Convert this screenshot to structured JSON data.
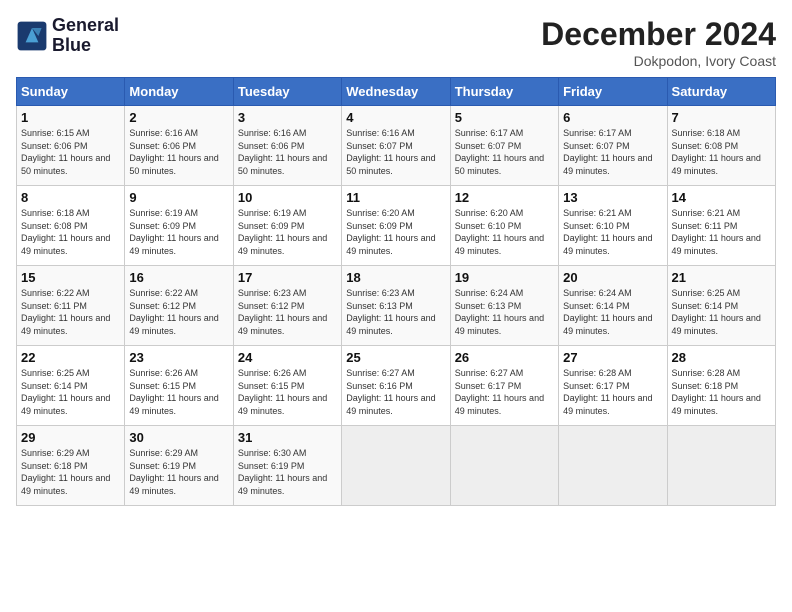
{
  "header": {
    "logo_line1": "General",
    "logo_line2": "Blue",
    "month_year": "December 2024",
    "location": "Dokpodon, Ivory Coast"
  },
  "weekdays": [
    "Sunday",
    "Monday",
    "Tuesday",
    "Wednesday",
    "Thursday",
    "Friday",
    "Saturday"
  ],
  "weeks": [
    [
      {
        "day": 1,
        "sunrise": "6:15 AM",
        "sunset": "6:06 PM",
        "daylight": "Daylight: 11 hours and 50 minutes."
      },
      {
        "day": 2,
        "sunrise": "6:16 AM",
        "sunset": "6:06 PM",
        "daylight": "Daylight: 11 hours and 50 minutes."
      },
      {
        "day": 3,
        "sunrise": "6:16 AM",
        "sunset": "6:06 PM",
        "daylight": "Daylight: 11 hours and 50 minutes."
      },
      {
        "day": 4,
        "sunrise": "6:16 AM",
        "sunset": "6:07 PM",
        "daylight": "Daylight: 11 hours and 50 minutes."
      },
      {
        "day": 5,
        "sunrise": "6:17 AM",
        "sunset": "6:07 PM",
        "daylight": "Daylight: 11 hours and 50 minutes."
      },
      {
        "day": 6,
        "sunrise": "6:17 AM",
        "sunset": "6:07 PM",
        "daylight": "Daylight: 11 hours and 49 minutes."
      },
      {
        "day": 7,
        "sunrise": "6:18 AM",
        "sunset": "6:08 PM",
        "daylight": "Daylight: 11 hours and 49 minutes."
      }
    ],
    [
      {
        "day": 8,
        "sunrise": "6:18 AM",
        "sunset": "6:08 PM",
        "daylight": "Daylight: 11 hours and 49 minutes."
      },
      {
        "day": 9,
        "sunrise": "6:19 AM",
        "sunset": "6:09 PM",
        "daylight": "Daylight: 11 hours and 49 minutes."
      },
      {
        "day": 10,
        "sunrise": "6:19 AM",
        "sunset": "6:09 PM",
        "daylight": "Daylight: 11 hours and 49 minutes."
      },
      {
        "day": 11,
        "sunrise": "6:20 AM",
        "sunset": "6:09 PM",
        "daylight": "Daylight: 11 hours and 49 minutes."
      },
      {
        "day": 12,
        "sunrise": "6:20 AM",
        "sunset": "6:10 PM",
        "daylight": "Daylight: 11 hours and 49 minutes."
      },
      {
        "day": 13,
        "sunrise": "6:21 AM",
        "sunset": "6:10 PM",
        "daylight": "Daylight: 11 hours and 49 minutes."
      },
      {
        "day": 14,
        "sunrise": "6:21 AM",
        "sunset": "6:11 PM",
        "daylight": "Daylight: 11 hours and 49 minutes."
      }
    ],
    [
      {
        "day": 15,
        "sunrise": "6:22 AM",
        "sunset": "6:11 PM",
        "daylight": "Daylight: 11 hours and 49 minutes."
      },
      {
        "day": 16,
        "sunrise": "6:22 AM",
        "sunset": "6:12 PM",
        "daylight": "Daylight: 11 hours and 49 minutes."
      },
      {
        "day": 17,
        "sunrise": "6:23 AM",
        "sunset": "6:12 PM",
        "daylight": "Daylight: 11 hours and 49 minutes."
      },
      {
        "day": 18,
        "sunrise": "6:23 AM",
        "sunset": "6:13 PM",
        "daylight": "Daylight: 11 hours and 49 minutes."
      },
      {
        "day": 19,
        "sunrise": "6:24 AM",
        "sunset": "6:13 PM",
        "daylight": "Daylight: 11 hours and 49 minutes."
      },
      {
        "day": 20,
        "sunrise": "6:24 AM",
        "sunset": "6:14 PM",
        "daylight": "Daylight: 11 hours and 49 minutes."
      },
      {
        "day": 21,
        "sunrise": "6:25 AM",
        "sunset": "6:14 PM",
        "daylight": "Daylight: 11 hours and 49 minutes."
      }
    ],
    [
      {
        "day": 22,
        "sunrise": "6:25 AM",
        "sunset": "6:14 PM",
        "daylight": "Daylight: 11 hours and 49 minutes."
      },
      {
        "day": 23,
        "sunrise": "6:26 AM",
        "sunset": "6:15 PM",
        "daylight": "Daylight: 11 hours and 49 minutes."
      },
      {
        "day": 24,
        "sunrise": "6:26 AM",
        "sunset": "6:15 PM",
        "daylight": "Daylight: 11 hours and 49 minutes."
      },
      {
        "day": 25,
        "sunrise": "6:27 AM",
        "sunset": "6:16 PM",
        "daylight": "Daylight: 11 hours and 49 minutes."
      },
      {
        "day": 26,
        "sunrise": "6:27 AM",
        "sunset": "6:17 PM",
        "daylight": "Daylight: 11 hours and 49 minutes."
      },
      {
        "day": 27,
        "sunrise": "6:28 AM",
        "sunset": "6:17 PM",
        "daylight": "Daylight: 11 hours and 49 minutes."
      },
      {
        "day": 28,
        "sunrise": "6:28 AM",
        "sunset": "6:18 PM",
        "daylight": "Daylight: 11 hours and 49 minutes."
      }
    ],
    [
      {
        "day": 29,
        "sunrise": "6:29 AM",
        "sunset": "6:18 PM",
        "daylight": "Daylight: 11 hours and 49 minutes."
      },
      {
        "day": 30,
        "sunrise": "6:29 AM",
        "sunset": "6:19 PM",
        "daylight": "Daylight: 11 hours and 49 minutes."
      },
      {
        "day": 31,
        "sunrise": "6:30 AM",
        "sunset": "6:19 PM",
        "daylight": "Daylight: 11 hours and 49 minutes."
      },
      null,
      null,
      null,
      null
    ]
  ]
}
